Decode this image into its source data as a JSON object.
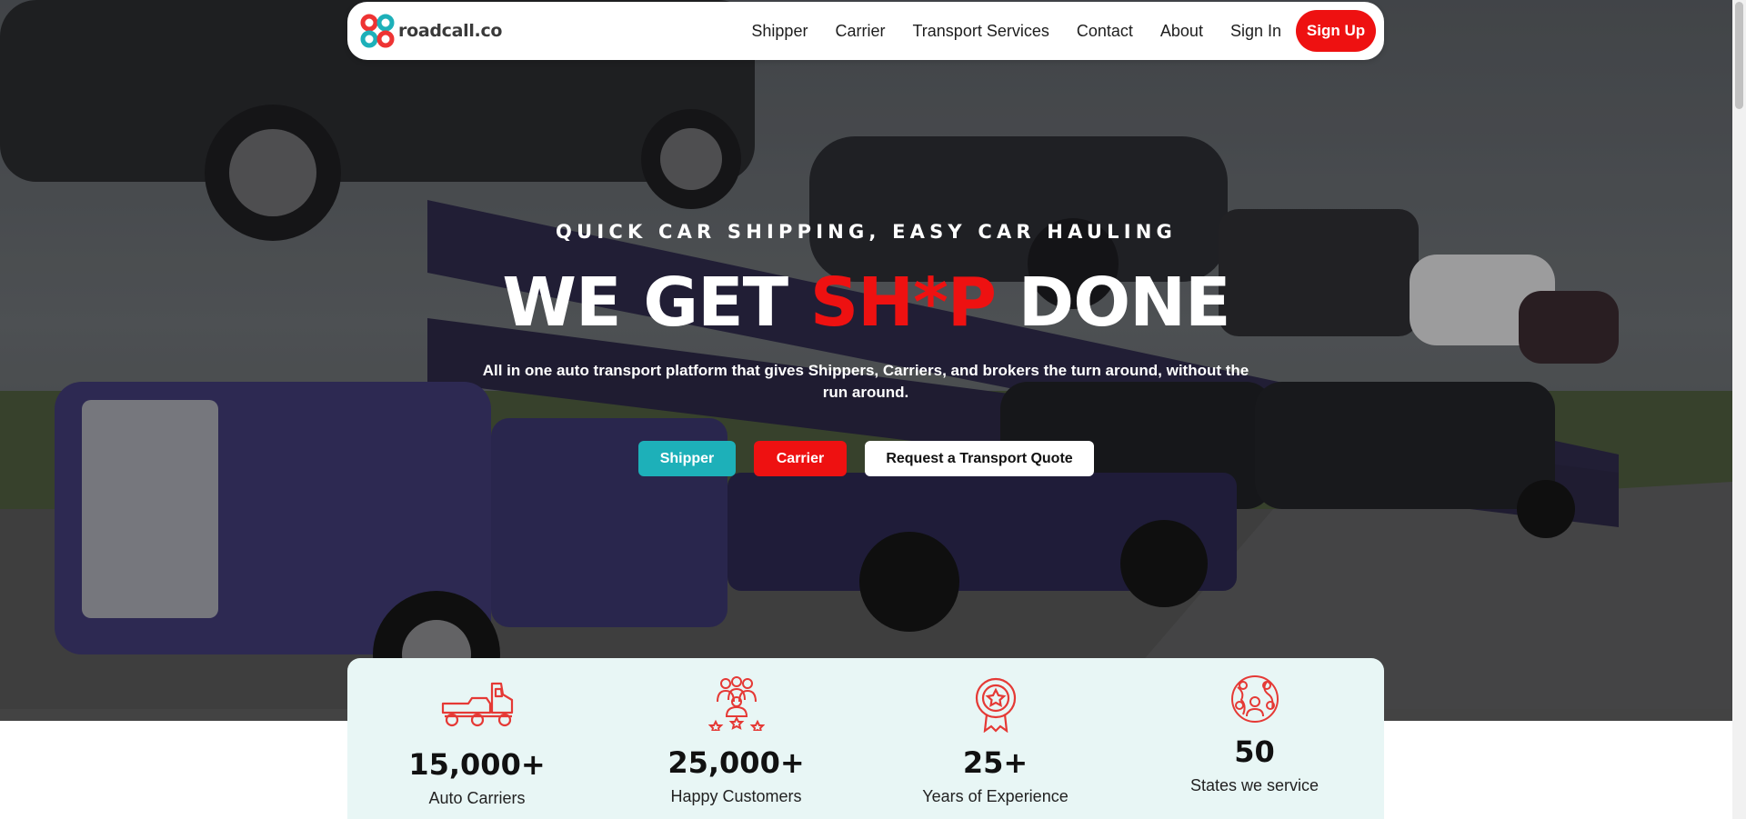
{
  "brand": {
    "name": "roadcall.co"
  },
  "nav": {
    "items": [
      "Shipper",
      "Carrier",
      "Transport Services",
      "Contact",
      "About",
      "Sign In"
    ],
    "signup_label": "Sign Up"
  },
  "hero": {
    "tagline": "QUICK CAR SHIPPING, EASY CAR HAULING",
    "headline_part1": "WE GET ",
    "headline_highlight": "SH*P",
    "headline_part2": " DONE",
    "subtext": "All in one auto transport platform that gives Shippers, Carriers, and brokers the turn around, without the run around.",
    "buttons": {
      "shipper": "Shipper",
      "carrier": "Carrier",
      "quote": "Request a Transport Quote"
    }
  },
  "stats": [
    {
      "icon": "car-hauler-truck-icon",
      "value": "15,000+",
      "label": "Auto Carriers"
    },
    {
      "icon": "happy-customers-icon",
      "value": "25,000+",
      "label": "Happy Customers"
    },
    {
      "icon": "award-badge-icon",
      "value": "25+",
      "label": "Years of Experience"
    },
    {
      "icon": "globe-people-icon",
      "value": "50",
      "label": "States we service"
    }
  ],
  "colors": {
    "accent_red": "#ee1111",
    "accent_teal": "#1db0b9",
    "stats_bg": "#e8f6f5"
  }
}
